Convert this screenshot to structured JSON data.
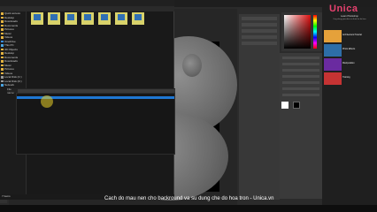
{
  "caption": "Cach do mau nen cho backround va su dung che do hoa tron - Unica.vn",
  "brand": {
    "logo": "Unica",
    "title": "Learn Photoshop",
    "subtitle": "Ung dung giao dien va thiet ke do hoa",
    "accent": "#e8416f"
  },
  "courses": [
    {
      "label": "Architectural Tutorial",
      "color": "#e5a13a"
    },
    {
      "label": "Photo Effects",
      "color": "#2d6ea8"
    },
    {
      "label": "Manipulation",
      "color": "#6a2ba0"
    },
    {
      "label": "Training",
      "color": "#c53333"
    }
  ],
  "explorer": {
    "nav_items": [
      "Quick access",
      "Desktop",
      "Downloads",
      "Documents",
      "Pictures",
      "Music",
      "Videos",
      "OneDrive",
      "This PC",
      "3D Objects",
      "Desktop",
      "Documents",
      "Downloads",
      "Music",
      "Pictures",
      "Videos",
      "Local Disk (C:)",
      "Local Disk (D:)",
      "Network"
    ],
    "files": [
      "",
      "",
      "",
      "",
      "",
      "",
      ""
    ],
    "status": "7 items"
  },
  "dialog": {
    "label": "File name:",
    "value": "",
    "list_items": [
      "",
      "",
      "",
      "",
      "",
      "",
      "",
      "",
      "",
      "",
      "",
      "",
      "",
      "",
      "",
      "",
      "",
      "",
      "",
      ""
    ],
    "selected_index": 1
  },
  "colors": {
    "selection": "#1e77d3",
    "folder": "#e3b341",
    "file_tile": "#d8d26a",
    "swatch_red": "#e01010"
  }
}
